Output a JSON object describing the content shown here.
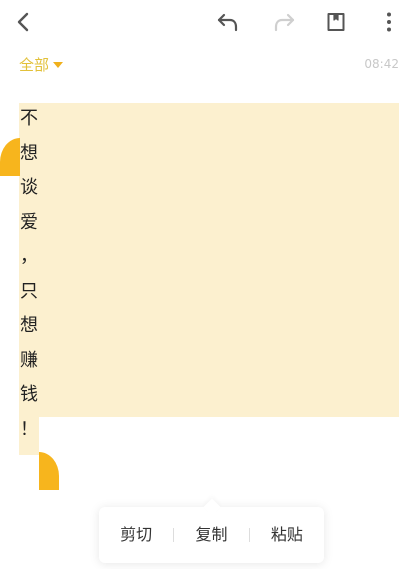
{
  "toolbar": {
    "icons": [
      "back-icon",
      "reply-icon",
      "forward-icon",
      "bookmark-icon",
      "more-icon"
    ],
    "colors": {
      "active": "#555555",
      "disabled": "#cfcfcf"
    }
  },
  "header": {
    "folder_label": "全部",
    "time": "08:42"
  },
  "message": {
    "characters": [
      "不",
      "想",
      "谈",
      "爱",
      "，",
      "只",
      "想",
      "赚",
      "钱",
      "！"
    ]
  },
  "context_menu": {
    "items": [
      {
        "label": "剪切"
      },
      {
        "label": "复制"
      },
      {
        "label": "粘贴"
      }
    ]
  },
  "colors": {
    "accent": "#f7b51d",
    "folder_text": "#e2c13a",
    "selection": "#fcf0cf",
    "time_text": "#c8c8c8"
  }
}
